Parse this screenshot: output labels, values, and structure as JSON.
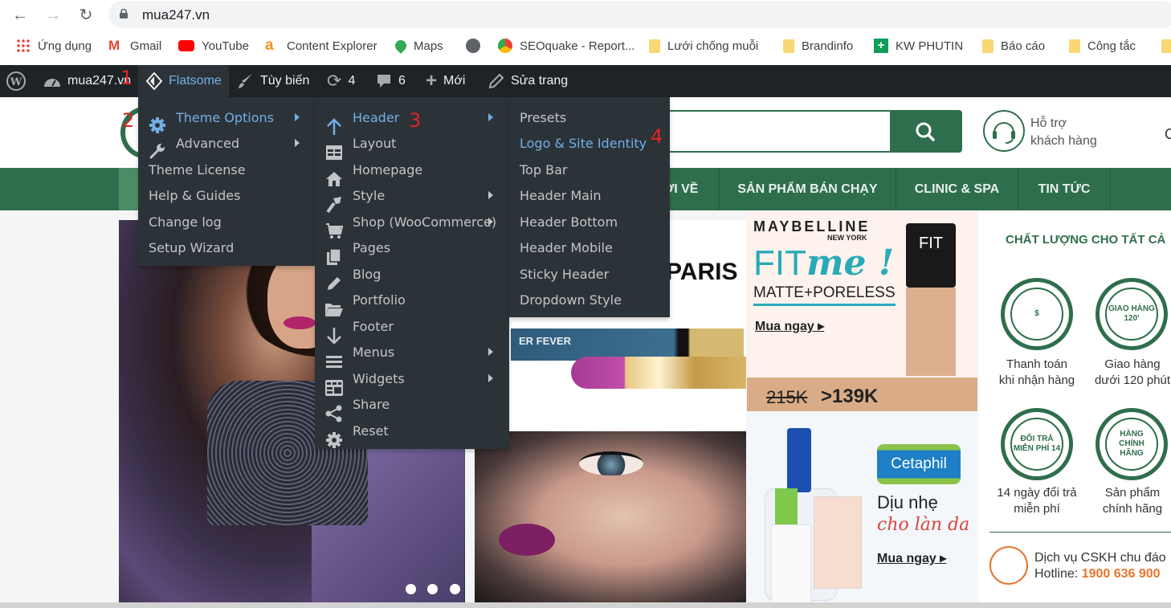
{
  "browser": {
    "url": "mua247.vn",
    "bookmarks": [
      {
        "label": "Ứng dụng",
        "icon": "apps-grid-icon"
      },
      {
        "label": "Gmail",
        "icon": "gmail-icon"
      },
      {
        "label": "YouTube",
        "icon": "youtube-icon"
      },
      {
        "label": "Content Explorer",
        "icon": "ahrefs-icon"
      },
      {
        "label": "Maps",
        "icon": "maps-pin-icon"
      },
      {
        "label": "",
        "icon": "globe-icon"
      },
      {
        "label": "SEOquake - Report...",
        "icon": "seoquake-icon"
      },
      {
        "label": "Lưới chống muỗi",
        "icon": "folder-icon"
      },
      {
        "label": "Brandinfo",
        "icon": "folder-icon"
      },
      {
        "label": "KW PHUTIN",
        "icon": "sheets-plus-icon"
      },
      {
        "label": "Báo cáo",
        "icon": "folder-icon"
      },
      {
        "label": "Công tắc",
        "icon": "folder-icon"
      }
    ]
  },
  "adminbar": {
    "site_name": "mua247.vn",
    "flatsome": "Flatsome",
    "customize": "Tùy biến",
    "updates_count": "4",
    "comments_count": "6",
    "new": "Mới",
    "edit_page": "Sửa trang",
    "annotations": [
      "1",
      "2",
      "3",
      "4"
    ]
  },
  "menu_level1": [
    {
      "label": "Theme Options",
      "icon": "gear-icon",
      "active": true,
      "submenu": true
    },
    {
      "label": "Advanced",
      "icon": "wrench-icon",
      "submenu": true
    },
    {
      "label": "Theme License"
    },
    {
      "label": "Help & Guides"
    },
    {
      "label": "Change log"
    },
    {
      "label": "Setup Wizard"
    }
  ],
  "menu_level2": [
    {
      "label": "Header",
      "icon": "arrow-up-icon",
      "active": true,
      "submenu": true
    },
    {
      "label": "Layout",
      "icon": "layout-icon"
    },
    {
      "label": "Homepage",
      "icon": "home-icon"
    },
    {
      "label": "Style",
      "icon": "paintbrush-icon",
      "submenu": true
    },
    {
      "label": "Shop (WooCommerce)",
      "icon": "cart-icon",
      "submenu": true
    },
    {
      "label": "Pages",
      "icon": "pages-icon"
    },
    {
      "label": "Blog",
      "icon": "pencil-icon"
    },
    {
      "label": "Portfolio",
      "icon": "folder-open-icon"
    },
    {
      "label": "Footer",
      "icon": "arrow-down-icon"
    },
    {
      "label": "Menus",
      "icon": "menu-lines-icon",
      "submenu": true
    },
    {
      "label": "Widgets",
      "icon": "widgets-icon",
      "submenu": true
    },
    {
      "label": "Share",
      "icon": "share-icon"
    },
    {
      "label": "Reset",
      "icon": "gear-icon"
    }
  ],
  "menu_level3": [
    {
      "label": "Presets"
    },
    {
      "label": "Logo & Site Identity",
      "active": true
    },
    {
      "label": "Top Bar"
    },
    {
      "label": "Header Main"
    },
    {
      "label": "Header Bottom"
    },
    {
      "label": "Header Mobile"
    },
    {
      "label": "Sticky Header"
    },
    {
      "label": "Dropdown Style"
    }
  ],
  "site": {
    "support_line1": "Hỗ trợ",
    "support_line2": "khách hàng",
    "nav": [
      "ỚI VỀ",
      "SẢN PHẨM BÁN CHẠY",
      "CLINIC & SPA",
      "TIN TỨC"
    ],
    "slide2_text": "PARIS",
    "eyeliner_text": "ER FEVER",
    "banner1": {
      "brand": "MAYBELLINE",
      "brand_sub": "NEW YORK",
      "product": "FITme!",
      "product_fit": "FIT",
      "product_me": "me !",
      "subtitle": "MATTE+PORELESS",
      "cta": "Mua ngay ▸",
      "old_price": "215K",
      "new_price": ">139K",
      "bottle_text": "FIT"
    },
    "banner2": {
      "brand": "Cetaphil",
      "line1": "Dịu nhẹ",
      "line2": "cho làn da",
      "cta": "Mua ngay ▸"
    },
    "sidebar": {
      "title": "CHẤT LƯỢNG CHO TẤT CẢ",
      "badges": [
        {
          "badge_text": "$",
          "label1": "Thanh toán",
          "label2": "khi nhận hàng"
        },
        {
          "badge_text": "GIAO HÀNG 120'",
          "label1": "Giao hàng",
          "label2": "dưới 120 phút"
        },
        {
          "badge_text": "ĐỔI TRẢ MIỄN PHÍ 14",
          "label1": "14 ngày đổi trả",
          "label2": "miễn phí"
        },
        {
          "badge_text": "HÀNG CHÍNH HÃNG",
          "label1": "Sản phẩm",
          "label2": "chính hãng"
        }
      ],
      "cskh": "Dịch vụ CSKH chu đáo",
      "hotline_label": "Hotline: ",
      "hotline": "1900 636 900"
    }
  },
  "colors": {
    "adminbar": "#1d2327",
    "menu": "#2c3338",
    "menu_active": "#72aee6",
    "brand_green": "#2f6e4c",
    "accent_orange": "#e8742c"
  }
}
